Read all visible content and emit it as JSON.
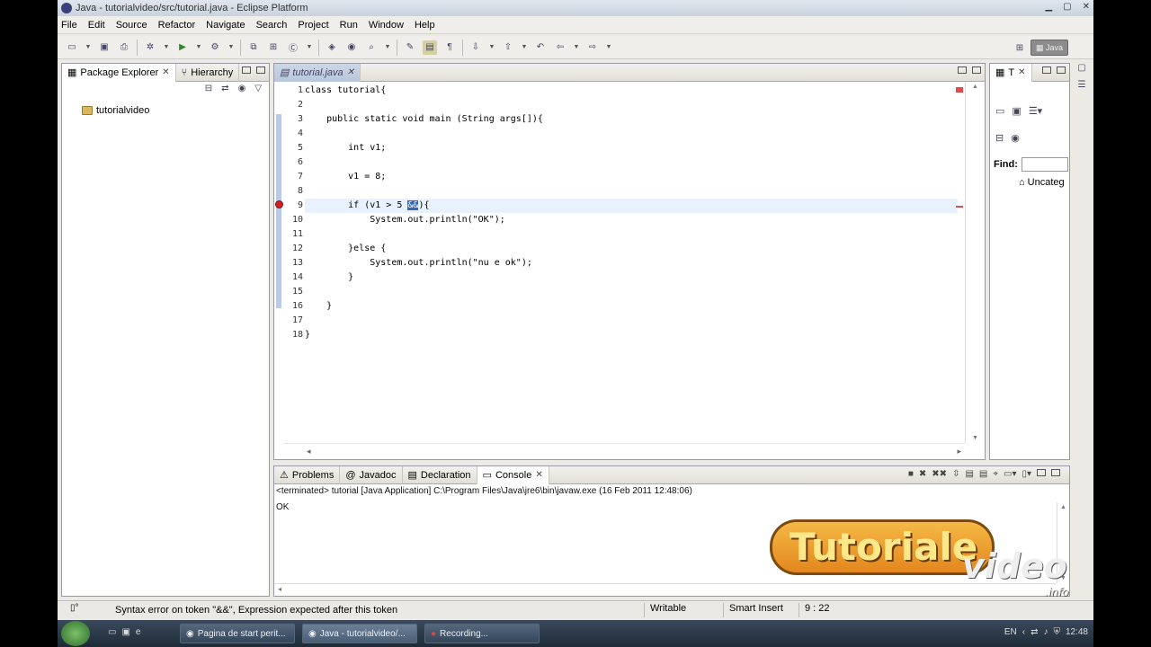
{
  "window": {
    "title": "Java - tutorialvideo/src/tutorial.java - Eclipse Platform"
  },
  "menu": [
    "File",
    "Edit",
    "Source",
    "Refactor",
    "Navigate",
    "Search",
    "Project",
    "Run",
    "Window",
    "Help"
  ],
  "left_panel": {
    "tabs": [
      {
        "label": "Package Explorer"
      },
      {
        "label": "Hierarchy"
      }
    ],
    "tree": [
      {
        "label": "tutorialvideo"
      }
    ]
  },
  "editor": {
    "tab": "tutorial.java",
    "line_numbers": [
      "1",
      "2",
      "3",
      "4",
      "5",
      "6",
      "7",
      "8",
      "9",
      "10",
      "11",
      "12",
      "13",
      "14",
      "15",
      "16",
      "17",
      "18"
    ],
    "lines": [
      "class tutorial{",
      "",
      "    public static void main (String args[]){",
      "",
      "        int v1;",
      "",
      "        v1 = 8;",
      "",
      "        if (v1 > 5 &&){",
      "            System.out.println(\"OK\");",
      "",
      "        }else {",
      "            System.out.println(\"nu e ok\");",
      "        }",
      "",
      "    }",
      "",
      "}"
    ],
    "error_line": "9",
    "selected_token": "&&"
  },
  "right_panel": {
    "tab": "T",
    "find_label": "Find:",
    "item": "Uncateg"
  },
  "console": {
    "tabs": [
      {
        "label": "Problems"
      },
      {
        "label": "Javadoc"
      },
      {
        "label": "Declaration"
      },
      {
        "label": "Console"
      }
    ],
    "header": "<terminated> tutorial [Java Application] C:\\Program Files\\Java\\jre6\\bin\\javaw.exe (16 Feb 2011 12:48:06)",
    "output": "OK"
  },
  "status": {
    "message": "Syntax error on token \"&&\", Expression expected after this token",
    "mode": "Writable",
    "insert": "Smart Insert",
    "position": "9 : 22"
  },
  "taskbar": {
    "items": [
      "Pagina de start perit...",
      "Java - tutorialvideo/...",
      "Recording..."
    ],
    "lang": "EN",
    "clock": "12:48"
  },
  "watermark": {
    "line1": "Tutoriale",
    "line2": "video",
    "line3": ".info"
  },
  "colors": {
    "selection": "#3166c1",
    "highlight_line": "#e8f2fe",
    "error": "#d32121"
  }
}
